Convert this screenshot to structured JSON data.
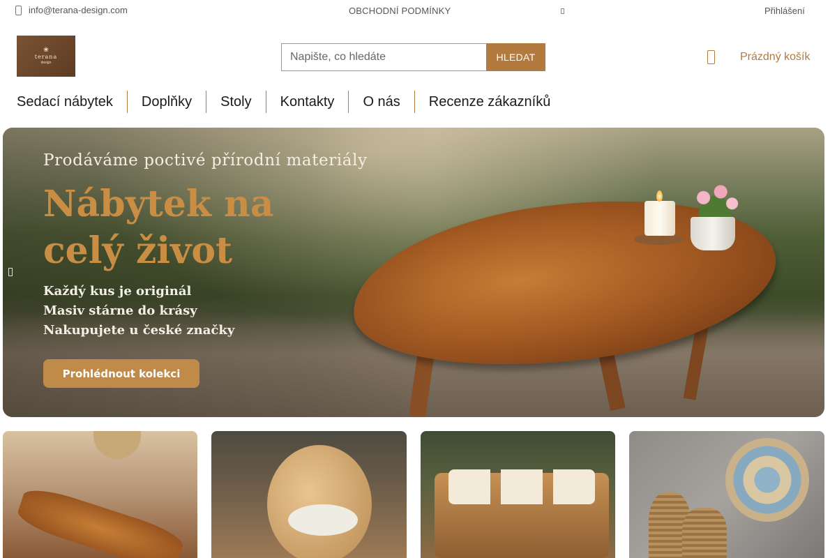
{
  "topbar": {
    "email": "info@terana-design.com",
    "terms": "OBCHODNÍ PODMÍNKY",
    "login": "Přihlášení"
  },
  "logo": {
    "name": "terana",
    "sub": "design"
  },
  "search": {
    "placeholder": "Napište, co hledáte",
    "button": "HLEDAT"
  },
  "cart": {
    "label": "Prázdný košík"
  },
  "nav": {
    "items": [
      "Sedací nábytek",
      "Doplňky",
      "Stoly",
      "Kontakty",
      "O nás",
      "Recenze zákazníků"
    ]
  },
  "hero": {
    "kicker": "Prodáváme poctivé přírodní materiály",
    "headline_line1": "Nábytek na",
    "headline_line2": "celý život",
    "bullets": [
      "Každý kus je originál",
      "Masiv stárne do krásy",
      "Nakupujete u české značky"
    ],
    "cta": "Prohlédnout kolekci"
  },
  "colors": {
    "accent": "#b27a3f",
    "headline": "#c98e43"
  }
}
